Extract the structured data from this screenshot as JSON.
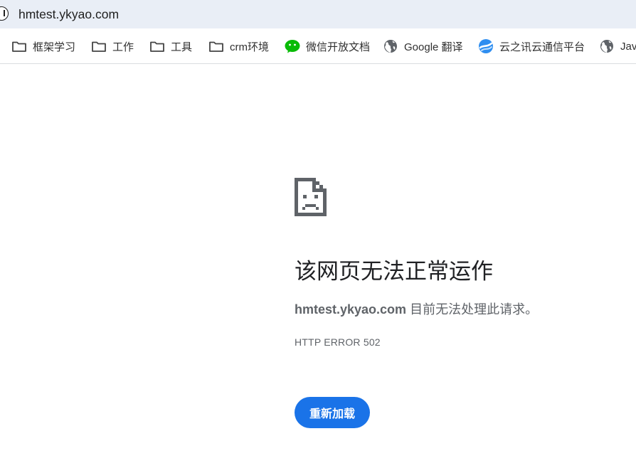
{
  "omnibox": {
    "url": "hmtest.ykyao.com"
  },
  "bookmarks": [
    {
      "label": "框架学习",
      "icon": "folder-icon"
    },
    {
      "label": "工作",
      "icon": "folder-icon"
    },
    {
      "label": "工具",
      "icon": "folder-icon"
    },
    {
      "label": "crm环境",
      "icon": "folder-icon"
    },
    {
      "label": "微信开放文档",
      "icon": "wechat-icon"
    },
    {
      "label": "Google 翻译",
      "icon": "globe-icon"
    },
    {
      "label": "云之讯云通信平台",
      "icon": "yunzhixun-icon"
    },
    {
      "label": "Java",
      "icon": "globe-icon"
    }
  ],
  "error_page": {
    "icon": "sad-page-icon",
    "headline": "该网页无法正常运作",
    "host": "hmtest.ykyao.com",
    "message": " 目前无法处理此请求。",
    "error_code": "HTTP ERROR 502",
    "reload_label": "重新加载"
  },
  "colors": {
    "omnibox_bg": "#e9eef6",
    "button_blue": "#1a73e8",
    "wechat_green": "#09bb07",
    "secondary_text": "#5f6368"
  }
}
